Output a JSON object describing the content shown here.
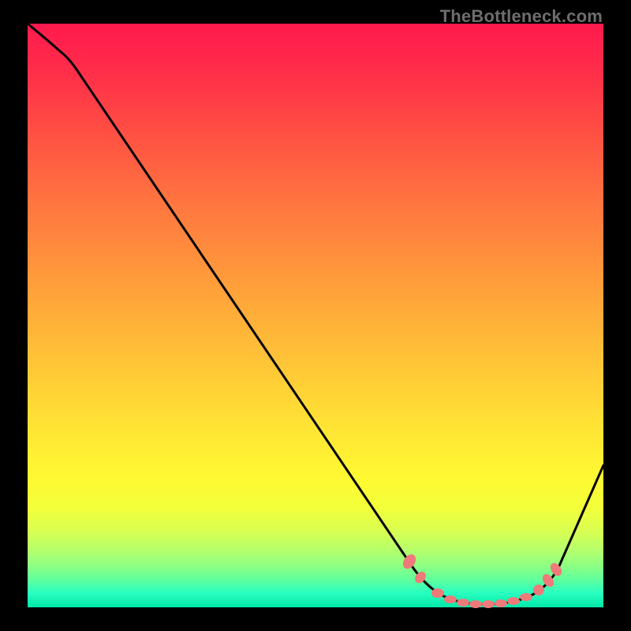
{
  "brand": "TheBottleneck.com",
  "chart_data": {
    "type": "line",
    "title": "",
    "xlabel": "",
    "ylabel": "",
    "xlim": [
      0,
      100
    ],
    "ylim": [
      0,
      100
    ],
    "series": [
      {
        "name": "curve",
        "x": [
          0,
          4,
          8,
          66,
          70,
          74,
          78,
          82,
          86,
          90,
          100
        ],
        "y": [
          100,
          97.5,
          95,
          8,
          4,
          1.5,
          0.5,
          0.5,
          1,
          3,
          25
        ],
        "color": "#000000"
      }
    ],
    "markers": {
      "name": "points",
      "x": [
        66,
        68,
        72,
        74,
        76,
        78,
        80,
        82,
        84,
        86,
        88,
        89,
        90
      ],
      "y": [
        8,
        6,
        2.5,
        1.5,
        1,
        0.5,
        0.5,
        0.5,
        0.7,
        1,
        1.8,
        2.3,
        3
      ],
      "color": "#f07878"
    },
    "gradient_stops": [
      {
        "pct": 0,
        "color": "#ff1a4d"
      },
      {
        "pct": 50,
        "color": "#ffb938"
      },
      {
        "pct": 80,
        "color": "#fff932"
      },
      {
        "pct": 100,
        "color": "#00e8a8"
      }
    ]
  }
}
